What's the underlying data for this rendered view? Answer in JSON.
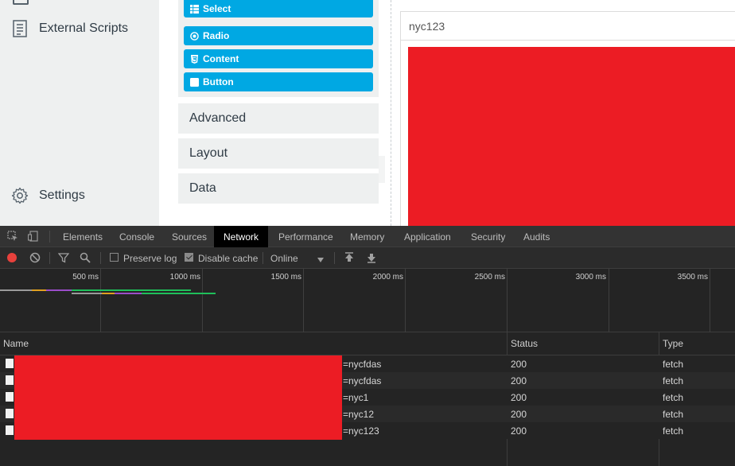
{
  "nav": {
    "external_scripts": "External Scripts",
    "settings": "Settings"
  },
  "components": {
    "buttons": [
      {
        "label": "Select",
        "icon": "table-icon"
      },
      {
        "label": "Radio",
        "icon": "radio-icon"
      },
      {
        "label": "Content",
        "icon": "html5-icon"
      },
      {
        "label": "Button",
        "icon": "square-icon"
      }
    ],
    "sections": [
      "Advanced",
      "Layout",
      "Data"
    ],
    "accent_color": "#00a8e3"
  },
  "preview": {
    "title": "nyc123",
    "redaction_color": "#ec1c24"
  },
  "devtools": {
    "tabs": [
      "Elements",
      "Console",
      "Sources",
      "Network",
      "Performance",
      "Memory",
      "Application",
      "Security",
      "Audits"
    ],
    "active_tab": "Network",
    "toolbar": {
      "preserve_log": "Preserve log",
      "preserve_log_checked": false,
      "disable_cache": "Disable cache",
      "disable_cache_checked": true,
      "throttle": "Online"
    },
    "timeline_ticks": [
      "500 ms",
      "1000 ms",
      "1500 ms",
      "2000 ms",
      "2500 ms",
      "3000 ms",
      "3500 ms"
    ],
    "columns": {
      "name": "Name",
      "status": "Status",
      "type": "Type"
    },
    "requests": [
      {
        "name": "=nycfdas",
        "status": "200",
        "type": "fetch"
      },
      {
        "name": "=nycfdas",
        "status": "200",
        "type": "fetch"
      },
      {
        "name": "=nyc1",
        "status": "200",
        "type": "fetch"
      },
      {
        "name": "=nyc12",
        "status": "200",
        "type": "fetch"
      },
      {
        "name": "=nyc123",
        "status": "200",
        "type": "fetch"
      }
    ]
  }
}
